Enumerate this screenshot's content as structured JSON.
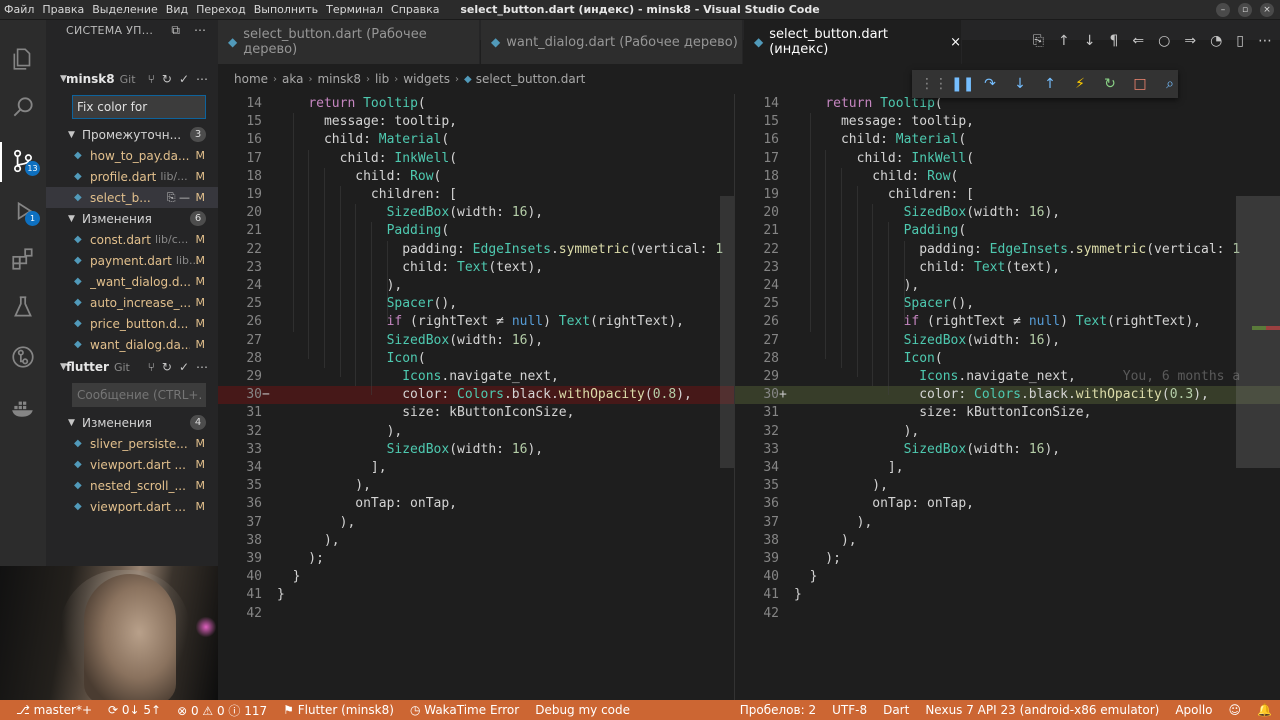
{
  "window": {
    "title": "select_button.dart (индекс) - minsk8 - Visual Studio Code",
    "menu": [
      "Файл",
      "Правка",
      "Выделение",
      "Вид",
      "Переход",
      "Выполнить",
      "Терминал",
      "Справка"
    ],
    "controls": [
      "–",
      "▫",
      "×"
    ]
  },
  "activity": {
    "items": [
      {
        "name": "explorer-icon"
      },
      {
        "name": "search-icon"
      },
      {
        "name": "source-control-icon",
        "badge": "13"
      },
      {
        "name": "run-debug-icon",
        "badge": "1"
      },
      {
        "name": "extensions-icon"
      },
      {
        "name": "testing-icon"
      },
      {
        "name": "git-graph-icon"
      },
      {
        "name": "docker-icon"
      }
    ]
  },
  "sidebar": {
    "title": "СИСТЕМА УП...",
    "repo1": {
      "name": "minsk8",
      "sub": "Git",
      "commit_value": "Fix color for",
      "groups": [
        {
          "label": "Промежуточн...",
          "count": "3",
          "files": [
            {
              "name": "how_to_pay.da...",
              "path": "",
              "status": "M"
            },
            {
              "name": "profile.dart",
              "path": "lib/...",
              "status": "M"
            },
            {
              "name": "select_b...",
              "path": "",
              "status": "M"
            }
          ]
        },
        {
          "label": "Изменения",
          "count": "6",
          "files": [
            {
              "name": "const.dart",
              "path": "lib/c...",
              "status": "M"
            },
            {
              "name": "payment.dart",
              "path": "lib...",
              "status": "M"
            },
            {
              "name": "_want_dialog.d...",
              "path": "",
              "status": "M"
            },
            {
              "name": "auto_increase_...",
              "path": "",
              "status": "M"
            },
            {
              "name": "price_button.d...",
              "path": "",
              "status": "M"
            },
            {
              "name": "want_dialog.da...",
              "path": "",
              "status": "M"
            }
          ]
        }
      ]
    },
    "repo2": {
      "name": "flutter",
      "sub": "Git",
      "commit_placeholder": "Сообщение (CTRL+...",
      "groups": [
        {
          "label": "Изменения",
          "count": "4",
          "files": [
            {
              "name": "sliver_persiste...",
              "status": "M"
            },
            {
              "name": "viewport.dart ...",
              "status": "M"
            },
            {
              "name": "nested_scroll_...",
              "status": "M"
            },
            {
              "name": "viewport.dart ...",
              "status": "M"
            }
          ]
        }
      ]
    }
  },
  "tabs": [
    {
      "label": "select_button.dart (Рабочее дерево)",
      "active": false
    },
    {
      "label": "want_dialog.dart (Рабочее дерево)",
      "active": false
    },
    {
      "label": "select_button.dart (индекс)",
      "active": true
    }
  ],
  "breadcrumb": [
    "home",
    "aka",
    "minsk8",
    "lib",
    "widgets",
    "select_button.dart"
  ],
  "debug_toolbar": [
    {
      "name": "drag-handle-icon",
      "glyph": "⋮⋮",
      "color": "#8a8a8a"
    },
    {
      "name": "pause-icon",
      "glyph": "❚❚",
      "color": "#75beff"
    },
    {
      "name": "step-over-icon",
      "glyph": "↷",
      "color": "#75beff"
    },
    {
      "name": "step-into-icon",
      "glyph": "↓",
      "color": "#75beff"
    },
    {
      "name": "step-out-icon",
      "glyph": "↑",
      "color": "#75beff"
    },
    {
      "name": "hot-reload-icon",
      "glyph": "⚡",
      "color": "#ffcc00"
    },
    {
      "name": "restart-icon",
      "glyph": "↻",
      "color": "#89d185"
    },
    {
      "name": "stop-icon",
      "glyph": "□",
      "color": "#f48771"
    },
    {
      "name": "inspect-widget-icon",
      "glyph": "⌕",
      "color": "#75beff"
    }
  ],
  "editor_actions": [
    "⎘",
    "↑",
    "↓",
    "¶",
    "⇐",
    "○",
    "⇒",
    "◔",
    "▯",
    "⋯"
  ],
  "diff": {
    "left_lines": [
      {
        "n": "14",
        "code": "    return Tooltip("
      },
      {
        "n": "15",
        "code": "      message: tooltip,"
      },
      {
        "n": "16",
        "code": "      child: Material("
      },
      {
        "n": "17",
        "code": "        child: InkWell("
      },
      {
        "n": "18",
        "code": "          child: Row("
      },
      {
        "n": "19",
        "code": "            children: ["
      },
      {
        "n": "20",
        "code": "              SizedBox(width: 16),"
      },
      {
        "n": "21",
        "code": "              Padding("
      },
      {
        "n": "22",
        "code": "                padding: EdgeInsets.symmetric(vertical: 1"
      },
      {
        "n": "23",
        "code": "                child: Text(text),"
      },
      {
        "n": "24",
        "code": "              ),"
      },
      {
        "n": "25",
        "code": "              Spacer(),"
      },
      {
        "n": "26",
        "code": "              if (rightText ≠ null) Text(rightText),"
      },
      {
        "n": "27",
        "code": "              SizedBox(width: 16),"
      },
      {
        "n": "28",
        "code": "              Icon("
      },
      {
        "n": "29",
        "code": "                Icons.navigate_next,"
      },
      {
        "n": "30",
        "code": "                color: Colors.black.withOpacity(0.8),",
        "type": "removed",
        "mark": "−"
      },
      {
        "n": "31",
        "code": "                size: kButtonIconSize,"
      },
      {
        "n": "32",
        "code": "              ),"
      },
      {
        "n": "33",
        "code": "              SizedBox(width: 16),"
      },
      {
        "n": "34",
        "code": "            ],"
      },
      {
        "n": "35",
        "code": "          ),"
      },
      {
        "n": "36",
        "code": "          onTap: onTap,"
      },
      {
        "n": "37",
        "code": "        ),"
      },
      {
        "n": "38",
        "code": "      ),"
      },
      {
        "n": "39",
        "code": "    );"
      },
      {
        "n": "40",
        "code": "  }"
      },
      {
        "n": "41",
        "code": "}"
      },
      {
        "n": "42",
        "code": ""
      }
    ],
    "right_lines": [
      {
        "n": "14",
        "code": "    return Tooltip("
      },
      {
        "n": "15",
        "code": "      message: tooltip,"
      },
      {
        "n": "16",
        "code": "      child: Material("
      },
      {
        "n": "17",
        "code": "        child: InkWell("
      },
      {
        "n": "18",
        "code": "          child: Row("
      },
      {
        "n": "19",
        "code": "            children: ["
      },
      {
        "n": "20",
        "code": "              SizedBox(width: 16),"
      },
      {
        "n": "21",
        "code": "              Padding("
      },
      {
        "n": "22",
        "code": "                padding: EdgeInsets.symmetric(vertical: 1"
      },
      {
        "n": "23",
        "code": "                child: Text(text),"
      },
      {
        "n": "24",
        "code": "              ),"
      },
      {
        "n": "25",
        "code": "              Spacer(),"
      },
      {
        "n": "26",
        "code": "              if (rightText ≠ null) Text(rightText),"
      },
      {
        "n": "27",
        "code": "              SizedBox(width: 16),"
      },
      {
        "n": "28",
        "code": "              Icon("
      },
      {
        "n": "29",
        "code": "                Icons.navigate_next,",
        "blame": "      You, 6 months a"
      },
      {
        "n": "30",
        "code": "                color: Colors.black.withOpacity(0.3),",
        "type": "added",
        "mark": "+"
      },
      {
        "n": "31",
        "code": "                size: kButtonIconSize,"
      },
      {
        "n": "32",
        "code": "              ),"
      },
      {
        "n": "33",
        "code": "              SizedBox(width: 16),"
      },
      {
        "n": "34",
        "code": "            ],"
      },
      {
        "n": "35",
        "code": "          ),"
      },
      {
        "n": "36",
        "code": "          onTap: onTap,"
      },
      {
        "n": "37",
        "code": "        ),"
      },
      {
        "n": "38",
        "code": "      ),"
      },
      {
        "n": "39",
        "code": "    );"
      },
      {
        "n": "40",
        "code": "  }"
      },
      {
        "n": "41",
        "code": "}"
      },
      {
        "n": "42",
        "code": ""
      }
    ]
  },
  "statusbar": {
    "left": [
      {
        "name": "branch-status",
        "text": "⎇ master*+"
      },
      {
        "name": "sync-status",
        "text": "⟳ 0↓ 5↑"
      },
      {
        "name": "problems-status",
        "text": "⊗ 0 ⚠ 0 ⓘ 117"
      },
      {
        "name": "flutter-status",
        "text": "⚑ Flutter (minsk8)"
      },
      {
        "name": "wakatime-status",
        "text": "◷ WakaTime Error"
      },
      {
        "name": "debug-my-code-status",
        "text": "Debug my code"
      }
    ],
    "right": [
      {
        "name": "indent-status",
        "text": "Пробелов: 2"
      },
      {
        "name": "encoding-status",
        "text": "UTF-8"
      },
      {
        "name": "language-status",
        "text": "Dart"
      },
      {
        "name": "device-status",
        "text": "Nexus 7 API 23 (android-x86 emulator)"
      },
      {
        "name": "apollo-status",
        "text": "Apollo"
      },
      {
        "name": "feedback-status",
        "text": "☺"
      },
      {
        "name": "notifications-status",
        "text": "🔔"
      }
    ]
  },
  "colors": {
    "accent": "#cc6633",
    "removed_bg": "#4b1818",
    "added_bg": "#373d29",
    "modified": "#e2c08d"
  }
}
